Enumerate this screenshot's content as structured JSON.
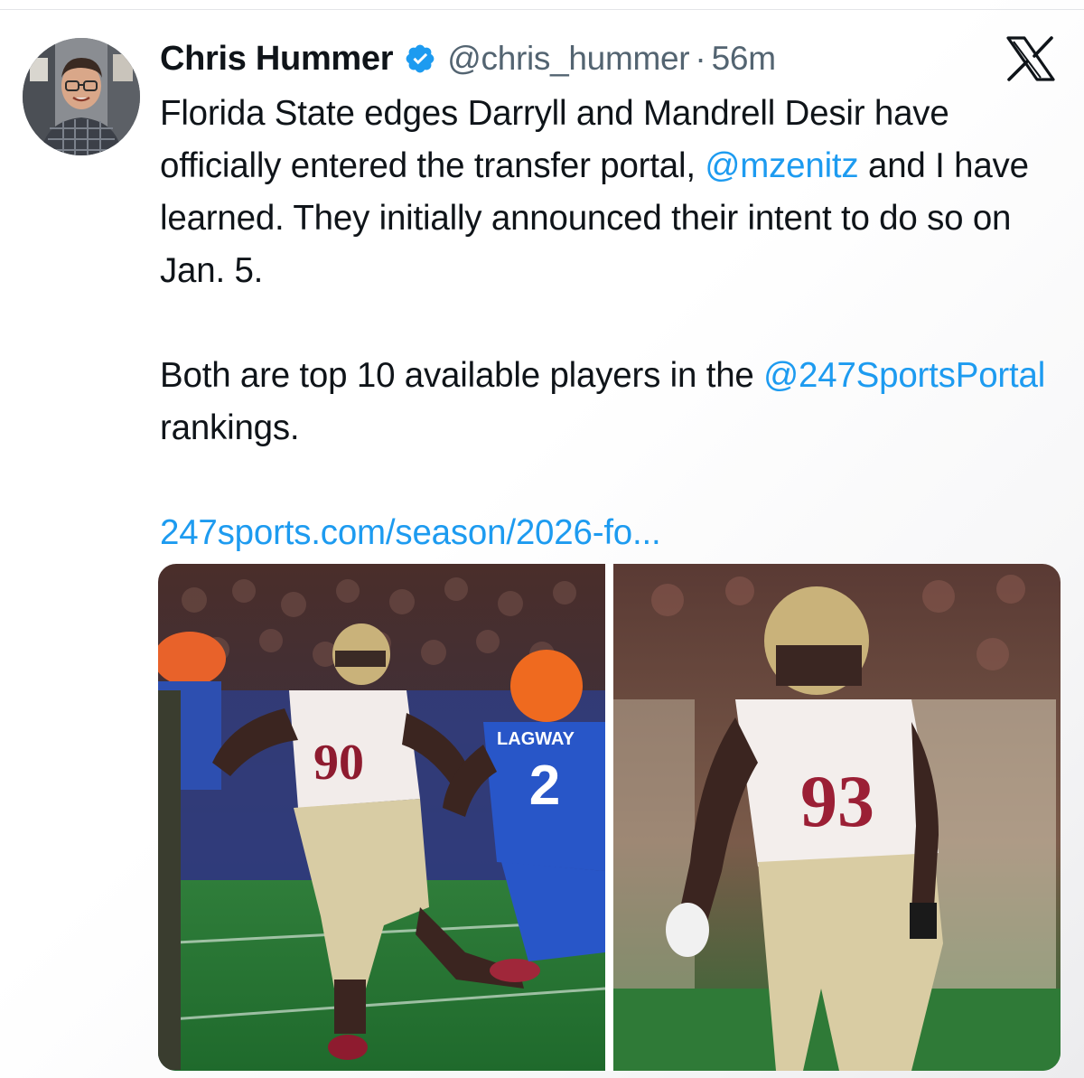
{
  "tweet": {
    "author": {
      "display_name": "Chris Hummer",
      "handle": "@chris_hummer",
      "verified": true,
      "avatar_icon": "profile-photo"
    },
    "separator": "·",
    "timestamp": "56m",
    "platform_icon": "x-logo-icon",
    "text": {
      "line1_prefix": "Florida State edges Darryll and Mandrell Desir have officially entered the transfer portal, ",
      "mention1": "@mzenitz",
      "line1_suffix": " and I have learned. They initially announced their intent to do so on Jan. 5.",
      "line2_prefix": "Both are top 10 available players in the ",
      "mention2": "@247SportsPortal",
      "line2_suffix": " rankings.",
      "link": "247sports.com/season/2026-fo..."
    },
    "media": [
      {
        "name": "photo-left",
        "jersey_names": [
          "LAGWAY"
        ],
        "jersey_numbers": [
          "90",
          "2"
        ]
      },
      {
        "name": "photo-right",
        "jersey_numbers": [
          "93"
        ]
      }
    ]
  },
  "colors": {
    "link": "#1d9bf0",
    "secondary_text": "#536471",
    "verified_badge": "#1d9bf0"
  }
}
